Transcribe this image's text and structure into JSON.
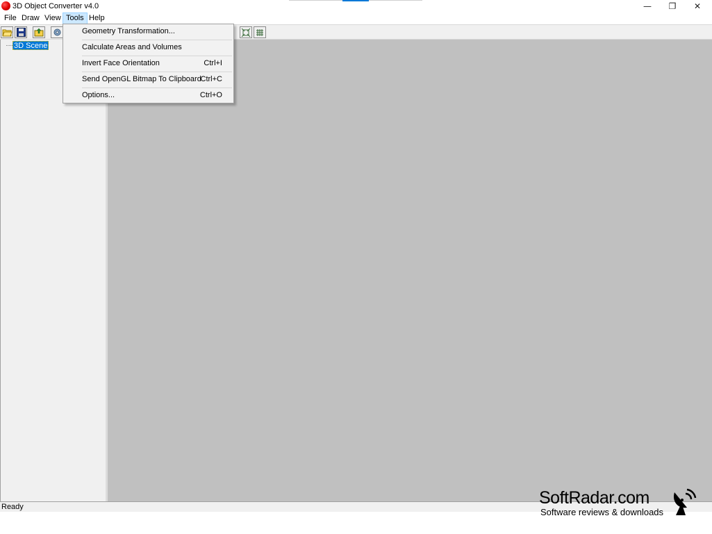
{
  "window": {
    "title": "3D Object Converter v4.0",
    "controls": {
      "minimize": "—",
      "restore": "❐",
      "close": "✕"
    }
  },
  "menubar": [
    {
      "label": "File"
    },
    {
      "label": "Draw"
    },
    {
      "label": "View"
    },
    {
      "label": "Tools",
      "active": true
    },
    {
      "label": "Help"
    }
  ],
  "tools_menu": {
    "items": [
      {
        "label": "Geometry Transformation...",
        "shortcut": ""
      },
      {
        "label": "Calculate Areas and Volumes",
        "shortcut": ""
      },
      {
        "label": "Invert Face Orientation",
        "shortcut": "Ctrl+I"
      },
      {
        "label": "Send OpenGL Bitmap To Clipboard",
        "shortcut": "Ctrl+C"
      },
      {
        "label": "Options...",
        "shortcut": "Ctrl+O"
      }
    ]
  },
  "toolbar": {
    "buttons": [
      "open-folder-icon",
      "save-disk-icon",
      "import-icon",
      "settings-gear-icon",
      "zoom-extents-icon",
      "grid-icon"
    ]
  },
  "tree": {
    "root": "3D Scene"
  },
  "status": {
    "text": "Ready"
  },
  "watermark": {
    "brand": "SoftRadar.com",
    "tagline": "Software reviews & downloads"
  },
  "colors": {
    "accent": "#0078d7",
    "viewport": "#c0c0c0",
    "menu_bg": "#f2f2f2"
  }
}
